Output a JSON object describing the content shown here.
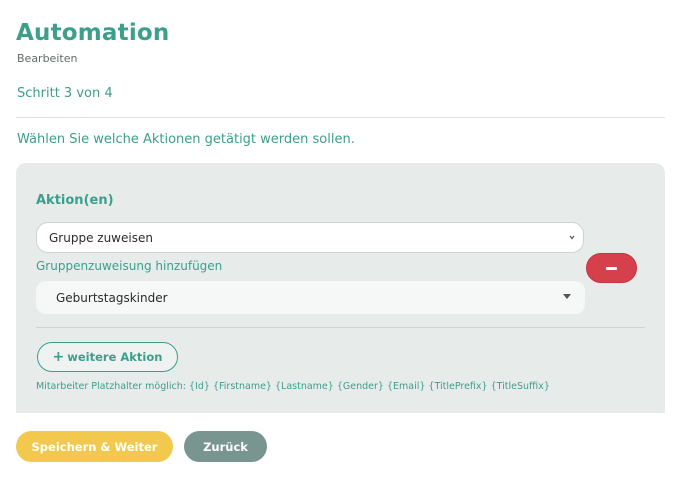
{
  "header": {
    "title": "Automation",
    "subtitle": "Bearbeiten",
    "step": "Schritt 3 von 4"
  },
  "instruction": "Wählen Sie welche Aktionen getätigt werden sollen.",
  "actions_panel": {
    "heading": "Aktion(en)",
    "action_select_value": "Gruppe zuweisen",
    "assign_link": "Gruppenzuweisung hinzufügen",
    "group_select_value": "Geburtstagskinder",
    "add_action_label": "weitere Aktion",
    "placeholder_hint": "Mitarbeiter Platzhalter möglich: {Id} {Firstname} {Lastname} {Gender} {Email} {TitlePrefix} {TitleSuffix}"
  },
  "footer": {
    "save_label": "Speichern & Weiter",
    "back_label": "Zurück"
  },
  "colors": {
    "accent": "#3d9e8c",
    "danger": "#d6404a",
    "primary_button": "#f2c94c",
    "secondary_button": "#79958f",
    "panel_background": "#e7eceb"
  },
  "icons": {
    "action_select": "chevron-updown-icon",
    "group_select": "caret-down-icon",
    "remove": "minus-icon",
    "add": "plus-icon"
  }
}
